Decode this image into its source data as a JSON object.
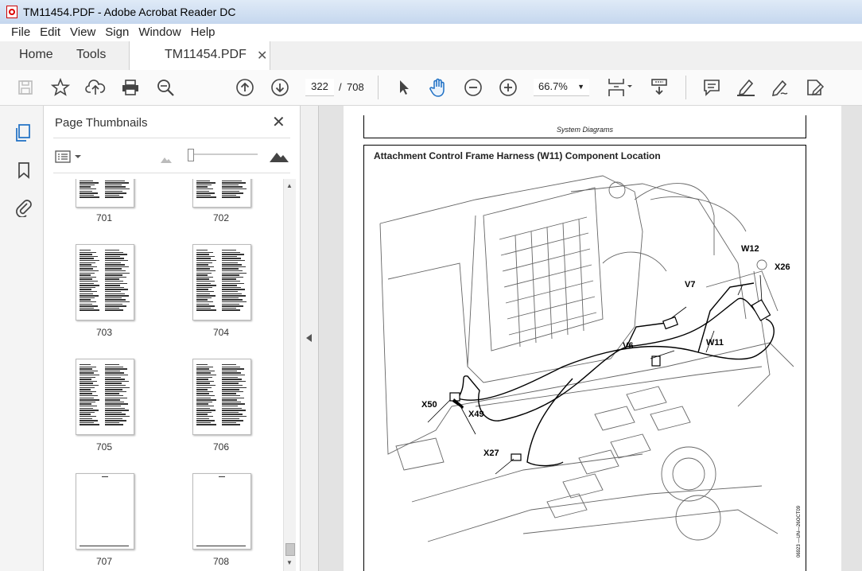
{
  "window": {
    "title": "TM11454.PDF - Adobe Acrobat Reader DC"
  },
  "menu": [
    "File",
    "Edit",
    "View",
    "Sign",
    "Window",
    "Help"
  ],
  "tabs": {
    "home": "Home",
    "tools": "Tools",
    "document": "TM11454.PDF"
  },
  "toolbar": {
    "current_page": "322",
    "page_separator": "/",
    "total_pages": "708",
    "zoom": "66.7%"
  },
  "thumbnails": {
    "title": "Page Thumbnails",
    "slider_fraction": 0.0,
    "pages": [
      "701",
      "702",
      "703",
      "704",
      "705",
      "706",
      "707",
      "708"
    ]
  },
  "document": {
    "header_caption": "System Diagrams",
    "figure_title": "Attachment Control Frame Harness (W11) Component Location",
    "callouts": {
      "w12": "W12",
      "x26": "X26",
      "v7": "V7",
      "v6": "V6",
      "w11": "W11",
      "x50": "X50",
      "x49": "X49",
      "x27": "X27"
    },
    "figure_id": "06923 —UN—26OCT09"
  },
  "colors": {
    "accent_blue": "#1d6fc4",
    "titlebar": "#c5d7ee"
  }
}
